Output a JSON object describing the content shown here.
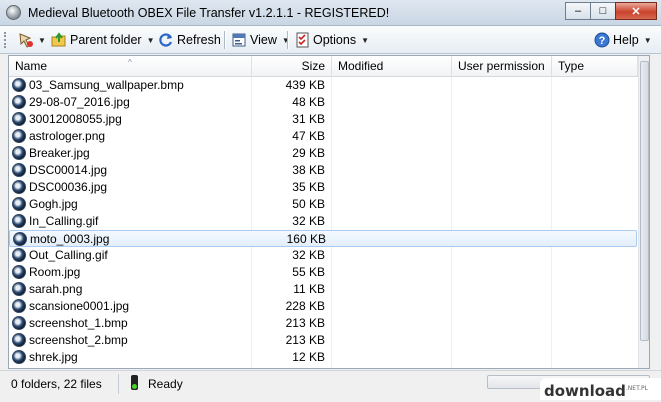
{
  "window": {
    "title": "Medieval Bluetooth OBEX File Transfer v1.2.1.1 - REGISTERED!",
    "controls": {
      "minimize": "–",
      "maximize": "□",
      "close": "✕"
    }
  },
  "toolbar": {
    "parent_folder": "Parent folder",
    "refresh": "Refresh",
    "view": "View",
    "options": "Options",
    "help": "Help",
    "dropdown_arrow": "▼"
  },
  "list": {
    "columns": [
      "Name",
      "Size",
      "Modified",
      "User permission",
      "Type"
    ],
    "sort_indicator": "^",
    "files": [
      {
        "name": "03_Samsung_wallpaper.bmp",
        "size": "439 KB"
      },
      {
        "name": "29-08-07_2016.jpg",
        "size": "48 KB"
      },
      {
        "name": "30012008055.jpg",
        "size": "31 KB"
      },
      {
        "name": "astrologer.png",
        "size": "47 KB"
      },
      {
        "name": "Breaker.jpg",
        "size": "29 KB"
      },
      {
        "name": "DSC00014.jpg",
        "size": "38 KB"
      },
      {
        "name": "DSC00036.jpg",
        "size": "35 KB"
      },
      {
        "name": "Gogh.jpg",
        "size": "50 KB"
      },
      {
        "name": "In_Calling.gif",
        "size": "32 KB"
      },
      {
        "name": "moto_0003.jpg",
        "size": "160 KB",
        "selected": true
      },
      {
        "name": "Out_Calling.gif",
        "size": "32 KB"
      },
      {
        "name": "Room.jpg",
        "size": "55 KB"
      },
      {
        "name": "sarah.png",
        "size": "11 KB"
      },
      {
        "name": "scansione0001.jpg",
        "size": "228 KB"
      },
      {
        "name": "screenshot_1.bmp",
        "size": "213 KB"
      },
      {
        "name": "screenshot_2.bmp",
        "size": "213 KB"
      },
      {
        "name": "shrek.jpg",
        "size": "12 KB"
      }
    ]
  },
  "status": {
    "counts": "0 folders, 22 files",
    "state": "Ready"
  },
  "watermark": {
    "brand": "download",
    "tld": ".NET.PL"
  }
}
